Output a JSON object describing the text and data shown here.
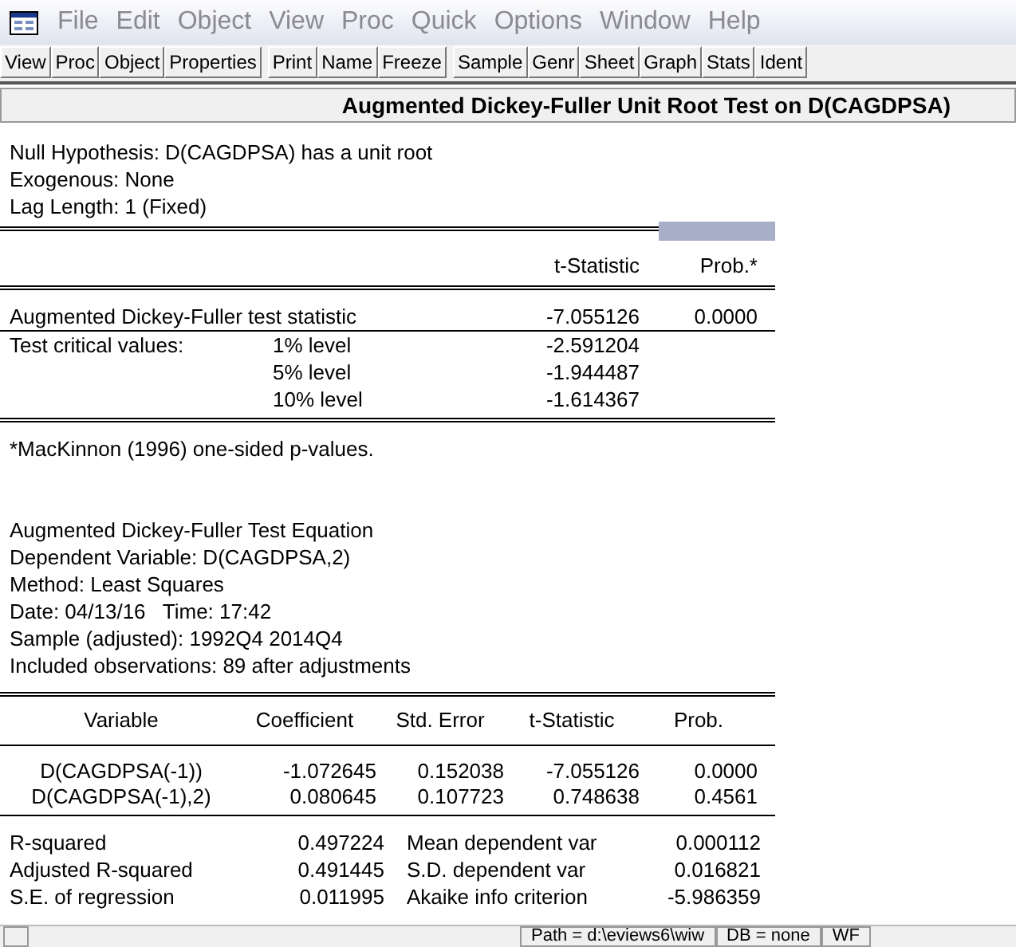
{
  "menu": [
    "File",
    "Edit",
    "Object",
    "View",
    "Proc",
    "Quick",
    "Options",
    "Window",
    "Help"
  ],
  "toolbar": [
    [
      "View",
      "Proc",
      "Object",
      "Properties"
    ],
    [
      "Print",
      "Name",
      "Freeze"
    ],
    [
      "Sample",
      "Genr",
      "Sheet",
      "Graph",
      "Stats",
      "Ident"
    ]
  ],
  "title": "Augmented Dickey-Fuller Unit Root Test on D(CAGDPSA)",
  "header_lines": [
    "Null Hypothesis: D(CAGDPSA) has a unit root",
    "Exogenous: None",
    "Lag Length: 1 (Fixed)"
  ],
  "adf_table": {
    "columns": [
      "t-Statistic",
      "Prob.*"
    ],
    "rows": [
      {
        "label": "Augmented Dickey-Fuller test statistic",
        "level": "",
        "t": "-7.055126",
        "prob": "0.0000"
      },
      {
        "label": "Test critical values:",
        "level": "1% level",
        "t": "-2.591204",
        "prob": ""
      },
      {
        "label": "",
        "level": "5% level",
        "t": "-1.944487",
        "prob": ""
      },
      {
        "label": "",
        "level": "10% level",
        "t": "-1.614367",
        "prob": ""
      }
    ]
  },
  "footnote": "*MacKinnon (1996) one-sided p-values.",
  "equation_lines": [
    "Augmented Dickey-Fuller Test Equation",
    "Dependent Variable: D(CAGDPSA,2)",
    "Method: Least Squares",
    "Date: 04/13/16   Time: 17:42",
    "Sample (adjusted): 1992Q4 2014Q4",
    "Included observations: 89 after adjustments"
  ],
  "coef_table": {
    "columns": [
      "Variable",
      "Coefficient",
      "Std. Error",
      "t-Statistic",
      "Prob."
    ],
    "rows": [
      [
        "D(CAGDPSA(-1))",
        "-1.072645",
        "0.152038",
        "-7.055126",
        "0.0000"
      ],
      [
        "D(CAGDPSA(-1),2)",
        "0.080645",
        "0.107723",
        "0.748638",
        "0.4561"
      ]
    ]
  },
  "stats": [
    [
      "R-squared",
      "0.497224",
      "Mean dependent var",
      "0.000112"
    ],
    [
      "Adjusted R-squared",
      "0.491445",
      "S.D. dependent var",
      "0.016821"
    ],
    [
      "S.E. of regression",
      "0.011995",
      "Akaike info criterion",
      "-5.986359"
    ]
  ],
  "status_bar": [
    "Path = d:\\eviews6\\wiw",
    "DB = none",
    "WF"
  ]
}
